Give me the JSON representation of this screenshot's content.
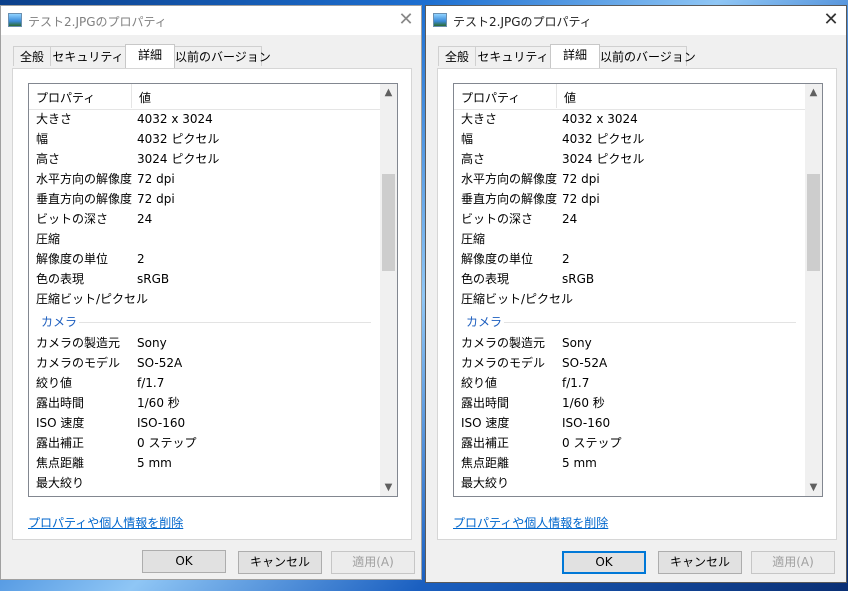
{
  "dialogs": [
    {
      "title": "テスト2.JPGのプロパティ",
      "close_glyph": "✕",
      "tabs": [
        "全般",
        "セキュリティ",
        "詳細",
        "以前のバージョン"
      ],
      "active_tab": "詳細",
      "list": {
        "col_property": "プロパティ",
        "col_value": "値",
        "image_rows": [
          {
            "k": "大きさ",
            "v": "4032 x 3024"
          },
          {
            "k": "幅",
            "v": "4032 ピクセル"
          },
          {
            "k": "高さ",
            "v": "3024 ピクセル"
          },
          {
            "k": "水平方向の解像度",
            "v": "72 dpi"
          },
          {
            "k": "垂直方向の解像度",
            "v": "72 dpi"
          },
          {
            "k": "ビットの深さ",
            "v": "24"
          },
          {
            "k": "圧縮",
            "v": ""
          },
          {
            "k": "解像度の単位",
            "v": "2"
          },
          {
            "k": "色の表現",
            "v": "sRGB"
          },
          {
            "k": "圧縮ビット/ピクセル",
            "v": ""
          }
        ],
        "camera_group": "カメラ",
        "camera_rows": [
          {
            "k": "カメラの製造元",
            "v": "Sony"
          },
          {
            "k": "カメラのモデル",
            "v": "SO-52A"
          },
          {
            "k": "絞り値",
            "v": "f/1.7"
          },
          {
            "k": "露出時間",
            "v": "1/60 秒"
          },
          {
            "k": "ISO 速度",
            "v": "ISO-160"
          },
          {
            "k": "露出補正",
            "v": "0 ステップ"
          },
          {
            "k": "焦点距離",
            "v": "5 mm"
          },
          {
            "k": "最大絞り",
            "v": ""
          }
        ]
      },
      "scroll_up_glyph": "▲",
      "scroll_down_glyph": "▼",
      "remove_link": "プロパティや個人情報を削除",
      "buttons": {
        "ok": "OK",
        "cancel": "キャンセル",
        "apply": "適用(A)"
      }
    },
    {
      "title": "テスト2.JPGのプロパティ",
      "close_glyph": "✕",
      "tabs": [
        "全般",
        "セキュリティ",
        "詳細",
        "以前のバージョン"
      ],
      "active_tab": "詳細",
      "list": {
        "col_property": "プロパティ",
        "col_value": "値",
        "image_rows": [
          {
            "k": "大きさ",
            "v": "4032 x 3024"
          },
          {
            "k": "幅",
            "v": "4032 ピクセル"
          },
          {
            "k": "高さ",
            "v": "3024 ピクセル"
          },
          {
            "k": "水平方向の解像度",
            "v": "72 dpi"
          },
          {
            "k": "垂直方向の解像度",
            "v": "72 dpi"
          },
          {
            "k": "ビットの深さ",
            "v": "24"
          },
          {
            "k": "圧縮",
            "v": ""
          },
          {
            "k": "解像度の単位",
            "v": "2"
          },
          {
            "k": "色の表現",
            "v": "sRGB"
          },
          {
            "k": "圧縮ビット/ピクセル",
            "v": ""
          }
        ],
        "camera_group": "カメラ",
        "camera_rows": [
          {
            "k": "カメラの製造元",
            "v": "Sony"
          },
          {
            "k": "カメラのモデル",
            "v": "SO-52A"
          },
          {
            "k": "絞り値",
            "v": "f/1.7"
          },
          {
            "k": "露出時間",
            "v": "1/60 秒"
          },
          {
            "k": "ISO 速度",
            "v": "ISO-160"
          },
          {
            "k": "露出補正",
            "v": "0 ステップ"
          },
          {
            "k": "焦点距離",
            "v": "5 mm"
          },
          {
            "k": "最大絞り",
            "v": ""
          }
        ]
      },
      "scroll_up_glyph": "▲",
      "scroll_down_glyph": "▼",
      "remove_link": "プロパティや個人情報を削除",
      "buttons": {
        "ok": "OK",
        "cancel": "キャンセル",
        "apply": "適用(A)"
      }
    }
  ],
  "colors": {
    "link": "#0066cc",
    "group_header": "#1e5fbf",
    "default_button_border": "#0078d7"
  }
}
